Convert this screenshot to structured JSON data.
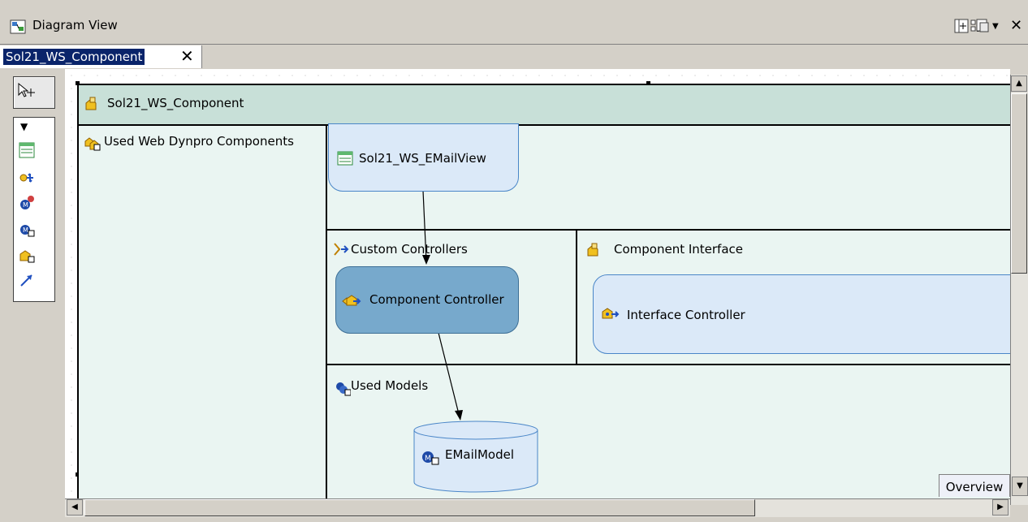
{
  "window": {
    "title": "Diagram View",
    "toolbar_icons": [
      "layout-icon",
      "label-toggle-icon",
      "export-icon"
    ],
    "menu_icon": "chevron-down-icon",
    "close_glyph": "✕"
  },
  "tab": {
    "label": "Sol21_WS_Component",
    "close_glyph": "✕"
  },
  "palette": {
    "tools": [
      "selection-tool-icon",
      "view-icon",
      "custom-controller-icon",
      "model-icon",
      "used-model-icon",
      "used-component-icon",
      "link-icon"
    ]
  },
  "diagram": {
    "component_name": "Sol21_WS_Component",
    "sections": {
      "used_components": "Used Web Dynpro Components",
      "custom_controllers": "Custom Controllers",
      "component_interface": "Component Interface",
      "used_models": "Used Models"
    },
    "nodes": {
      "view": "Sol21_WS_EMailView",
      "component_controller": "Component Controller",
      "interface_controller": "Interface Controller",
      "model": "EMailModel"
    }
  },
  "overview": {
    "label": "Overview"
  },
  "colors": {
    "header_green": "#c8e0d8",
    "section_bg": "#eaf5f2",
    "node_bg": "#dbe9f8",
    "controller_bg": "#77a9cc",
    "tab_selected": "#0a246a"
  }
}
